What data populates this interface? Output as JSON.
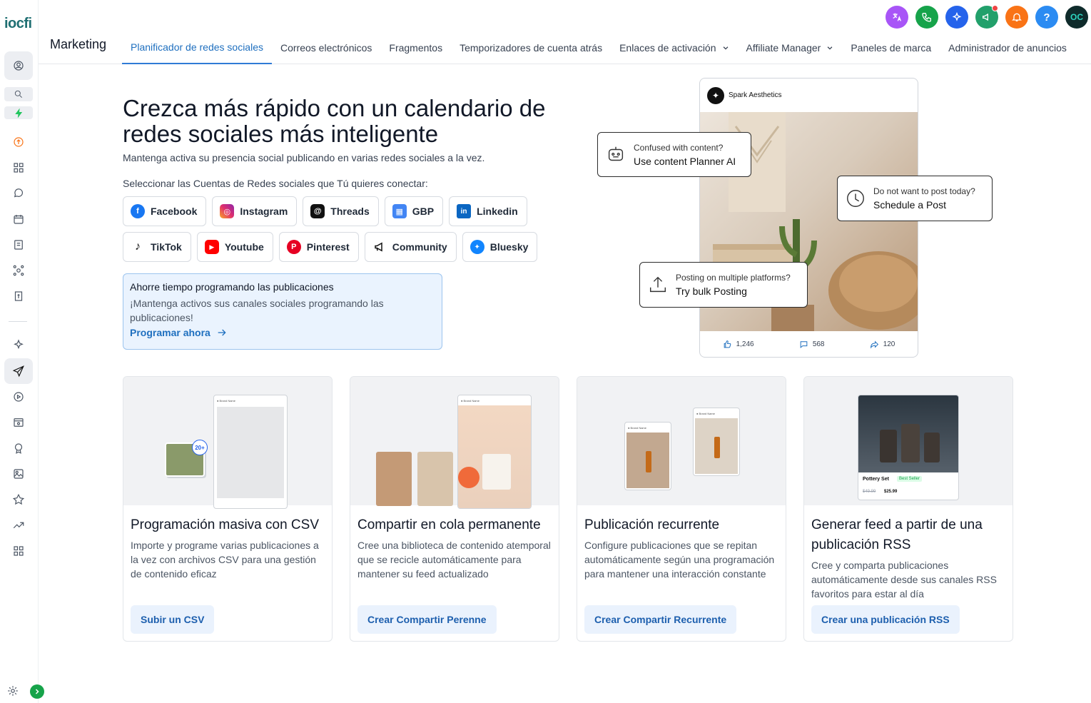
{
  "app": {
    "logo_text": "iocfi",
    "brand": "Marketing",
    "colors": {
      "accent": "#1e6fbf",
      "translate": "#a855f7",
      "phone": "#16a34a",
      "ai": "#2563eb",
      "megaphone": "#22a06b",
      "bell": "#f97316",
      "help": "#2b8bf2",
      "profile": "#0f2b2b"
    }
  },
  "topbar": {
    "icons": [
      "translate-icon",
      "phone-icon",
      "ai-sparkle-icon",
      "megaphone-icon",
      "bell-icon",
      "help-icon",
      "profile-avatar"
    ],
    "help_label": "?",
    "avatar_label": "OC"
  },
  "nav": {
    "tabs": [
      {
        "label": "Planificador de redes sociales",
        "active": true
      },
      {
        "label": "Correos electrónicos"
      },
      {
        "label": "Fragmentos"
      },
      {
        "label": "Temporizadores de cuenta atrás"
      },
      {
        "label": "Enlaces de activación",
        "dropdown": true
      },
      {
        "label": "Affiliate Manager",
        "dropdown": true
      },
      {
        "label": "Paneles de marca"
      },
      {
        "label": "Administrador de anuncios"
      }
    ]
  },
  "hero": {
    "title": "Crezca más rápido con un calendario de redes sociales más inteligente",
    "subtitle": "Mantenga activa su presencia social publicando en varias redes sociales a la vez.",
    "select_label": "Seleccionar las Cuentas de Redes sociales que Tú quieres conectar:"
  },
  "platforms_row1": [
    {
      "label": "Facebook",
      "icon": "facebook-icon",
      "color": "#1877f2",
      "glyph": "f"
    },
    {
      "label": "Instagram",
      "icon": "instagram-icon",
      "color": "#e1306c",
      "glyph": "◎"
    },
    {
      "label": "Threads",
      "icon": "threads-icon",
      "color": "#111111",
      "glyph": "@"
    },
    {
      "label": "GBP",
      "icon": "gbp-icon",
      "color": "#4285f4",
      "glyph": "▦"
    },
    {
      "label": "Linkedin",
      "icon": "linkedin-icon",
      "color": "#0a66c2",
      "glyph": "in"
    }
  ],
  "platforms_row2": [
    {
      "label": "TikTok",
      "icon": "tiktok-icon",
      "color": "#111111",
      "glyph": "♪"
    },
    {
      "label": "Youtube",
      "icon": "youtube-icon",
      "color": "#ff0000",
      "glyph": "▶"
    },
    {
      "label": "Pinterest",
      "icon": "pinterest-icon",
      "color": "#e60023",
      "glyph": "P"
    },
    {
      "label": "Community",
      "icon": "community-megaphone-icon",
      "color": "#111111",
      "glyph": "📢"
    },
    {
      "label": "Bluesky",
      "icon": "bluesky-icon",
      "color": "#1185fe",
      "glyph": "🦋"
    }
  ],
  "promo": {
    "title": "Ahorre tiempo programando las publicaciones",
    "text": "¡Mantenga activos sus canales sociales programando las publicaciones!",
    "link": "Programar ahora"
  },
  "mockup": {
    "account": "Spark Aesthetics",
    "likes": "1,246",
    "comments": "568",
    "shares": "120",
    "bubble1_q": "Confused with content?",
    "bubble1_a": "Use content Planner AI",
    "bubble2_q": "Do not want to post today?",
    "bubble2_a": "Schedule a Post",
    "bubble3_q": "Posting on multiple platforms?",
    "bubble3_a": "Try bulk Posting"
  },
  "cards": [
    {
      "title": "Programación masiva con CSV",
      "desc": "Importe y programe varias publicaciones a la vez con archivos CSV para una gestión de contenido eficaz",
      "button": "Subir un CSV",
      "badge": "20+"
    },
    {
      "title": "Compartir en cola permanente",
      "desc": "Cree una biblioteca de contenido atemporal que se recicle automáticamente para mantener su feed actualizado",
      "button": "Crear Compartir Perenne"
    },
    {
      "title": "Publicación recurrente",
      "desc": "Configure publicaciones que se repitan automáticamente según una programación para mantener una interacción constante",
      "button": "Crear Compartir Recurrente"
    },
    {
      "title": "Generar feed a partir de una publicación RSS",
      "desc": "Cree y comparta publicaciones automáticamente desde sus canales RSS favoritos para estar al día",
      "button": "Crear una publicación RSS",
      "product": "Pottery Set",
      "tag": "Best Seller",
      "old_price": "$49.99",
      "price": "$25.99"
    }
  ]
}
